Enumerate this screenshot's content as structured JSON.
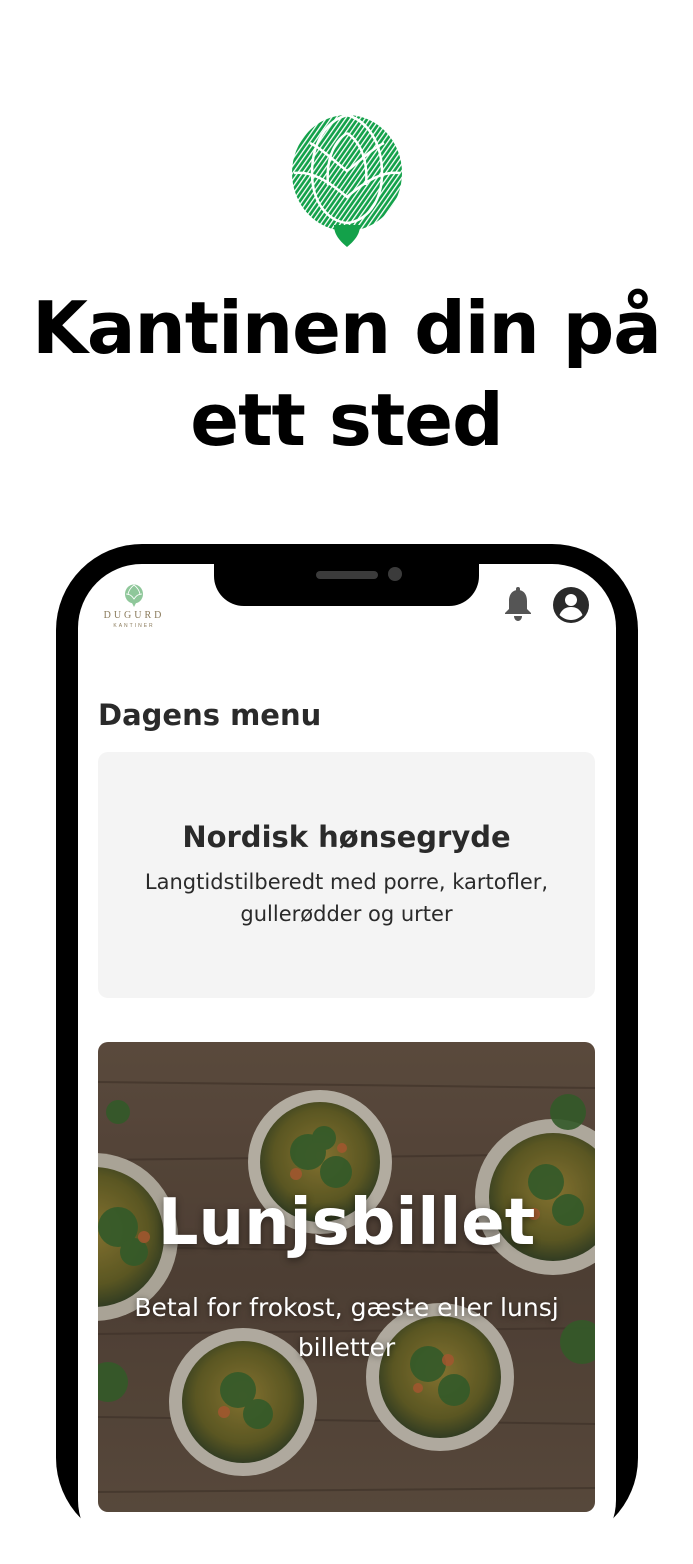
{
  "headline": {
    "line1": "Kantinen din på",
    "line2": "ett sted"
  },
  "app": {
    "brand_name": "DUGURD",
    "brand_sub": "KANTINER",
    "notifications_icon": "bell-icon",
    "account_icon": "account-circle-icon"
  },
  "section": {
    "title": "Dagens menu"
  },
  "dish": {
    "name": "Nordisk hønsegryde",
    "description": "Langtidstilberedt med porre, kartofler, gullerødder og urter"
  },
  "ticket": {
    "title": "Lunjsbillet",
    "description": "Betal for frokost, gæste eller lunsj billetter"
  },
  "colors": {
    "brand_green": "#13a14a",
    "headline_text": "#000000",
    "card_background": "#f4f4f4",
    "body_text": "#2a2a2a",
    "phone_frame": "#000000"
  }
}
